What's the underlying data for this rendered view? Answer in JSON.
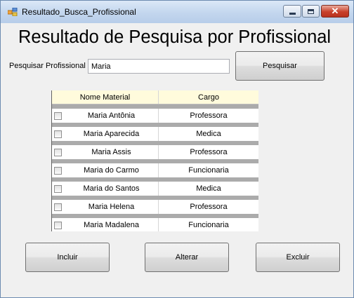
{
  "window": {
    "title": "Resultado_Busca_Profissional"
  },
  "heading": "Resultado de Pesquisa por Profissional",
  "search": {
    "label": "Pesquisar Profissional",
    "value": "Maria",
    "button_label": "Pesquisar"
  },
  "grid": {
    "columns": [
      "Nome Material",
      "Cargo"
    ],
    "rows": [
      {
        "nome": "Maria Antônia",
        "cargo": "Professora"
      },
      {
        "nome": "Maria Aparecida",
        "cargo": "Medica"
      },
      {
        "nome": "Maria Assis",
        "cargo": "Professora"
      },
      {
        "nome": "Maria do Carmo",
        "cargo": "Funcionaria"
      },
      {
        "nome": "Maria do Santos",
        "cargo": "Medica"
      },
      {
        "nome": "Maria Helena",
        "cargo": "Professora"
      },
      {
        "nome": "Maria Madalena",
        "cargo": "Funcionaria"
      }
    ]
  },
  "actions": {
    "incluir": "Incluir",
    "alterar": "Alterar",
    "excluir": "Excluir"
  },
  "colors": {
    "header_bg": "#fffbdc",
    "separator": "#ababab",
    "titlebar": "#c3d6ee"
  }
}
